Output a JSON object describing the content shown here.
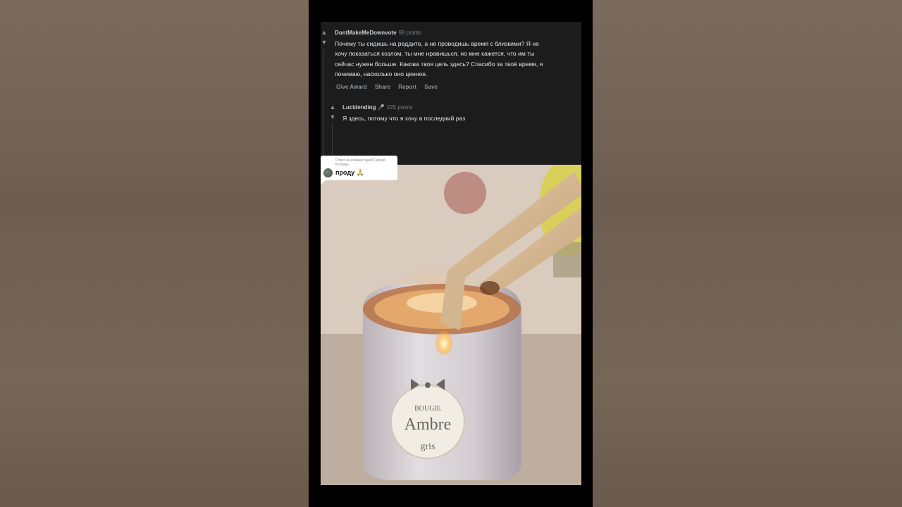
{
  "comment1": {
    "author": "DontMakeMeDownvote",
    "points": "99 points",
    "lines": [
      "Почему ты сидишь на реддите, а не проводишь время с близкими? Я не",
      "хочу показаться козлом, ты мне нравишься, но мне кажется, что им ты",
      "сейчас нужен больше. Какова твоя цель здесь? Спасибо за твоё время, я",
      "понимаю, насколько оно ценное."
    ],
    "actions": [
      "Give Award",
      "Share",
      "Report",
      "Save"
    ]
  },
  "comment2": {
    "author": "Lucidending 🎤",
    "points": "225 points",
    "text": "Я здесь, потому что я хочу в последний раз"
  },
  "reply_sticker": {
    "meta": "Ответ на комментарий Сергей Кобзарь",
    "text": "проду 🙏"
  },
  "video": {
    "label_small": "BOUGIE",
    "label_main": "Ambre",
    "label_sub": "gris"
  },
  "colors": {
    "card_bg": "#1c1c1d",
    "player_bg": "#000000",
    "backdrop": "#6f6154"
  }
}
